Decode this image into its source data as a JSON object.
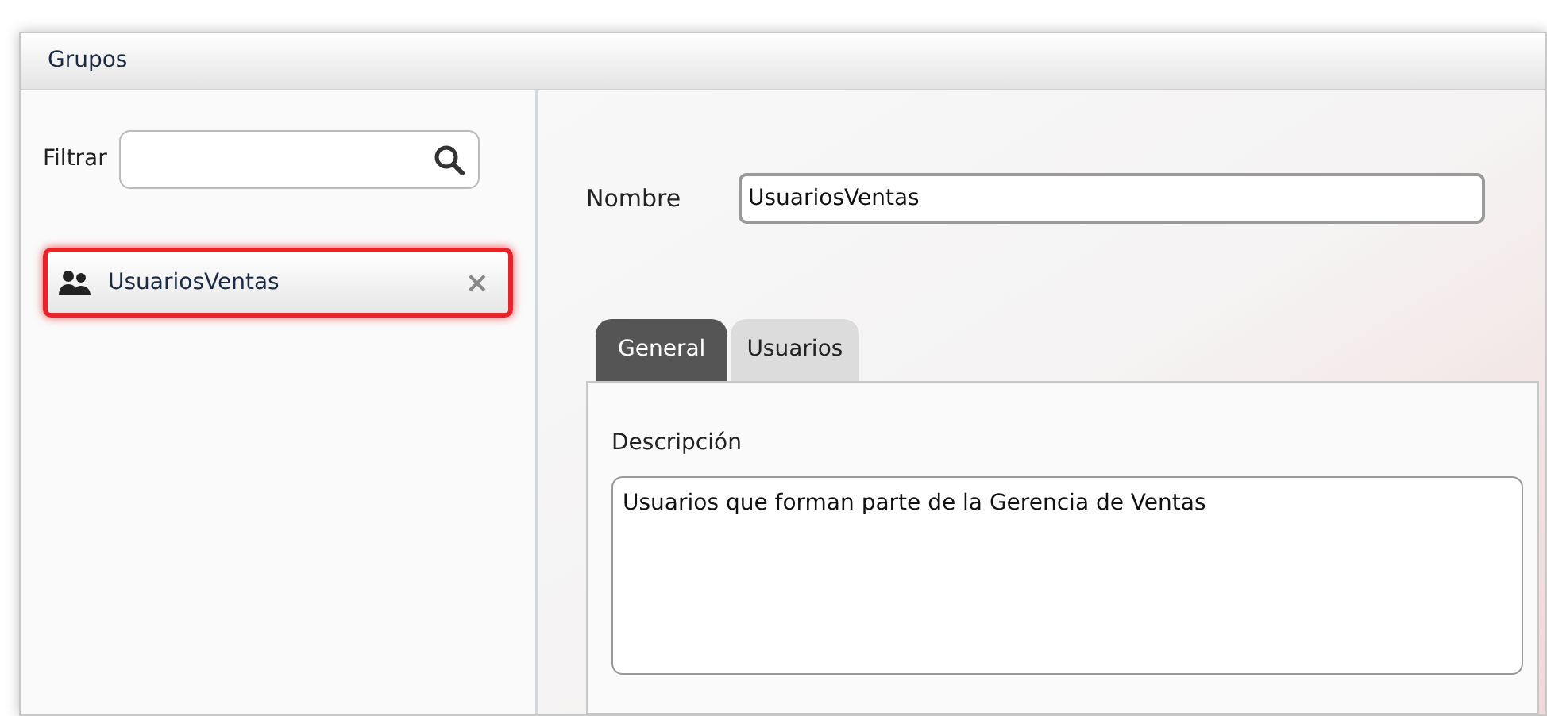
{
  "window": {
    "title": "Grupos"
  },
  "filter": {
    "label": "Filtrar"
  },
  "groups": [
    {
      "name": "UsuariosVentas",
      "selected": true,
      "remove": "×"
    }
  ],
  "name_field": {
    "label": "Nombre",
    "value": "UsuariosVentas"
  },
  "tabs": [
    {
      "label": "General",
      "selected": true
    },
    {
      "label": "Usuarios",
      "selected": false
    }
  ],
  "description": {
    "label": "Descripción",
    "value": "Usuarios que forman parte de la Gerencia de Ventas"
  }
}
